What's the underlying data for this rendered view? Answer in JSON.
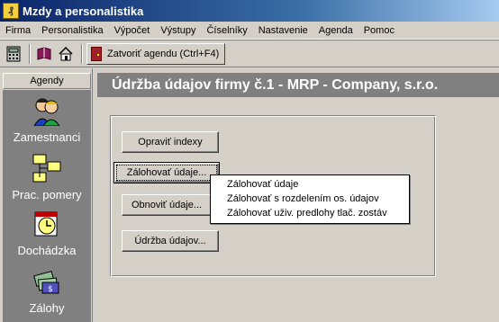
{
  "window": {
    "title": "Mzdy a personalistika"
  },
  "menu": [
    "Firma",
    "Personalistika",
    "Výpočet",
    "Výstupy",
    "Číselníky",
    "Nastavenie",
    "Agenda",
    "Pomoc"
  ],
  "toolbar": {
    "close_agenda_label": "Zatvoriť agendu (Ctrl+F4)"
  },
  "sidebar": {
    "title": "Agendy",
    "items": [
      {
        "label": "Zamestnanci",
        "icon": "people-icon"
      },
      {
        "label": "Prac. pomery",
        "icon": "org-chart-icon"
      },
      {
        "label": "Dochádzka",
        "icon": "calendar-clock-icon"
      },
      {
        "label": "Zálohy",
        "icon": "money-icon"
      }
    ]
  },
  "main": {
    "title": "Údržba údajov firmy č.1 - MRP -  Company, s.r.o.",
    "buttons": [
      {
        "label": "Opraviť indexy"
      },
      {
        "label": "Zálohovať údaje..."
      },
      {
        "label": "Obnoviť údaje..."
      },
      {
        "label": "Údržba údajov..."
      }
    ]
  },
  "popup": {
    "items": [
      "Zálohovať údaje",
      "Zálohovať s rozdelením os. údajov",
      "Zálohovať uživ. predlohy tlač. zostáv"
    ]
  }
}
